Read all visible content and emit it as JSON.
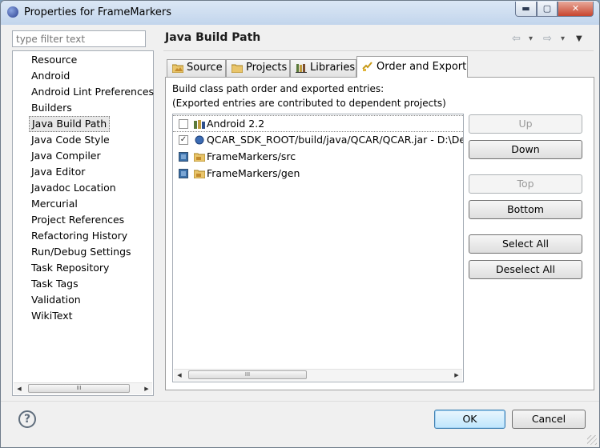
{
  "window": {
    "title": "Properties for FrameMarkers",
    "controls": {
      "minimize": "▬",
      "maximize": "▢",
      "close": "✕"
    }
  },
  "filter": {
    "placeholder": "type filter text"
  },
  "nav": {
    "items": [
      "Resource",
      "Android",
      "Android Lint Preferences",
      "Builders",
      "Java Build Path",
      "Java Code Style",
      "Java Compiler",
      "Java Editor",
      "Javadoc Location",
      "Mercurial",
      "Project References",
      "Refactoring History",
      "Run/Debug Settings",
      "Task Repository",
      "Task Tags",
      "Validation",
      "WikiText"
    ],
    "selected": "Java Build Path",
    "scroll": {
      "left": "◀",
      "right": "▶",
      "thumb": "III"
    }
  },
  "page": {
    "title": "Java Build Path",
    "back_icon": "⇦",
    "forward_icon": "⇨",
    "dropdown": "▾",
    "menu": "▼"
  },
  "tabs": [
    "Source",
    "Projects",
    "Libraries",
    "Order and Export"
  ],
  "active_tab": "Order and Export",
  "description": {
    "line1": "Build class path order and exported entries:",
    "line2": "(Exported entries are contributed to dependent projects)"
  },
  "entries": [
    {
      "label": "Android 2.2",
      "checked": false,
      "icon": "library-icon"
    },
    {
      "label": "QCAR_SDK_ROOT/build/java/QCAR/QCAR.jar - D:\\Deve",
      "checked": true,
      "icon": "jar-variable-icon"
    },
    {
      "label": "FrameMarkers/src",
      "checked": true,
      "icon": "source-folder-icon"
    },
    {
      "label": "FrameMarkers/gen",
      "checked": true,
      "icon": "source-folder-icon"
    }
  ],
  "buttons": {
    "up": "Up",
    "down": "Down",
    "top": "Top",
    "bottom": "Bottom",
    "select_all": "Select All",
    "deselect_all": "Deselect All"
  },
  "footer": {
    "help": "?",
    "ok": "OK",
    "cancel": "Cancel"
  },
  "colors": {
    "accent": "#3c7fb1",
    "titlebar": "#c2d5ec"
  }
}
